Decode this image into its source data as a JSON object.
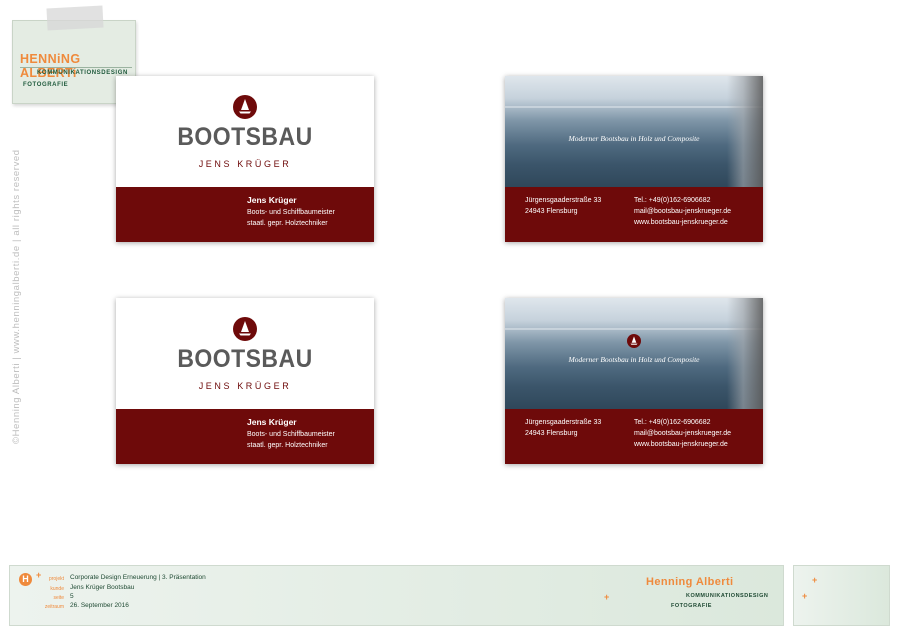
{
  "studio_logo": {
    "name": "HENNiNG ALBERTi",
    "line1": "KOMMUNIKATIONSDESIGN",
    "line2": "FOTOGRAFIE"
  },
  "side_copyright": "©Henning Alberti  |  www.henningalberti.de  |  all rights reserved",
  "card_front": {
    "brand": "BOOTSBAU",
    "sub": "JENS KRÜGER",
    "name": "Jens Krüger",
    "title1": "Boots- und Schiffbaumeister",
    "title2": "staatl. gepr. Holztechniker"
  },
  "card_back": {
    "tagline": "Moderner Bootsbau in Holz und Composite",
    "street": "Jürgensgaaderstraße 33",
    "city": "24943 Flensburg",
    "tel": "Tel.: +49(0)162-6906682",
    "mail": "mail@bootsbau-jenskrueger.de",
    "web": "www.bootsbau-jenskrueger.de"
  },
  "footer": {
    "logo_letter": "H",
    "labels": {
      "projekt": "projekt",
      "kunde": "kunde",
      "seite": "seite",
      "zeitraum": "zeitraum"
    },
    "projekt": "Corporate Design Erneuerung  |  3. Präsentation",
    "kunde": "Jens Krüger Bootsbau",
    "seite": "5",
    "zeitraum": "26. September 2016",
    "brand": "Henning Alberti",
    "brand_line1": "KOMMUNIKATIONSDESIGN",
    "brand_line2": "FOTOGRAFIE"
  },
  "colors": {
    "brand_red": "#6e0a0a",
    "accent_orange": "#ef8a3c",
    "footer_green": "#1f4a33"
  }
}
